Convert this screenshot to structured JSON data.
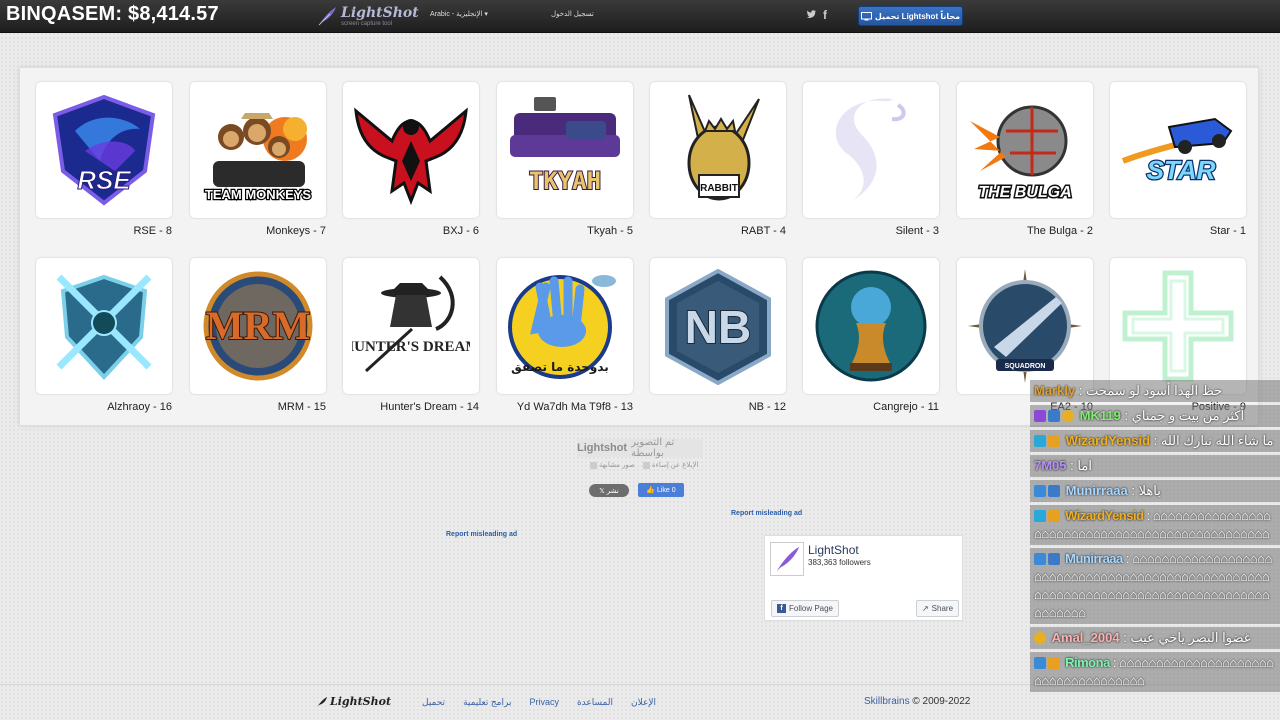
{
  "header": {
    "balance_text": "BINQASEM: $8,414.57",
    "logo_title": "LightShot",
    "logo_subtitle": "screen capture tool",
    "language": "Arabic - الإنجليزية",
    "login": "تسجيل الدخول",
    "download_button": "تحميل Lightshot مجاناً"
  },
  "gallery": {
    "rows": [
      [
        {
          "label": "RSE - 8",
          "icon": "rse-logo-icon"
        },
        {
          "label": "Monkeys - 7",
          "icon": "team-monkeys-logo-icon"
        },
        {
          "label": "BXJ - 6",
          "icon": "red-eagle-logo-icon"
        },
        {
          "label": "Tkyah - 5",
          "icon": "tkyah-couch-logo-icon"
        },
        {
          "label": "RABT - 4",
          "icon": "rabbit-logo-icon"
        },
        {
          "label": "Silent - 3",
          "icon": "silent-s-logo-icon"
        },
        {
          "label": "The Bulga - 2",
          "icon": "the-bulga-logo-icon"
        },
        {
          "label": "Star - 1",
          "icon": "star-car-logo-icon"
        }
      ],
      [
        {
          "label": "Alzhraoy - 16",
          "icon": "crossed-swords-shield-icon"
        },
        {
          "label": "MRM - 15",
          "icon": "mrm-logo-icon"
        },
        {
          "label": "Hunter's Dream - 14",
          "icon": "hunters-dream-logo-icon"
        },
        {
          "label": "Yd Wa7dh Ma T9f8 - 13",
          "icon": "crying-hand-logo-icon"
        },
        {
          "label": "NB - 12",
          "icon": "nb-hexagon-logo-icon"
        },
        {
          "label": "Cangrejo - 11",
          "icon": "trophy-logo-icon"
        },
        {
          "label": "EA2 - 10",
          "icon": "squadron-jet-logo-icon"
        },
        {
          "label": "Positive - 9",
          "icon": "positive-cross-logo-icon"
        }
      ]
    ],
    "logo_texts": {
      "rse": "RSE",
      "team_monkeys": "TEAM MONKEYS",
      "tkyah": "TKYAH",
      "rabbit": "RABBIT",
      "bulga": "THE BULGA",
      "star": "STAR",
      "mrm": "MRM",
      "hunters": "HUNTER'S DREAM",
      "nb": "NB",
      "squadron": "SQUADRON",
      "crying_hand": "بدوحدة ما تصفق"
    }
  },
  "share": {
    "shot_by_prefix": "تم التصوير بواسطة",
    "shot_by_brand": "Lightshot",
    "report": "الإبلاغ عن إساءة",
    "similar": "صور مشابهة",
    "post_x": "نشر",
    "like": "Like 0",
    "report_ad_1": "Report misleading ad",
    "report_ad_2": "Report misleading ad"
  },
  "fb_widget": {
    "page_name": "LightShot",
    "followers": "383,363 followers",
    "follow": "Follow Page",
    "share": "Share"
  },
  "footer": {
    "logo": "LightShot",
    "links": [
      "تحميل",
      "برامج تعليمية",
      "Privacy",
      "المساعدة",
      "الإعلان"
    ],
    "copyright_brand": "Skillbrains",
    "copyright_rest": " © 2009-2022"
  },
  "chat": {
    "messages": [
      {
        "user": "Markly",
        "text": ": حظ الهدا أسود لو سمحت",
        "user_color": "#e0a030"
      },
      {
        "user": "MK119",
        "text": ": أكثر من بيت و جمناي",
        "user_color": "#7cf06a"
      },
      {
        "user": "WizardYensid",
        "text": ": ما شاء الله تبارك الله",
        "user_color": "#f0b020"
      },
      {
        "user": "7M05",
        "text": ": اما",
        "user_color": "#b890ff"
      },
      {
        "user": "Munirraaa",
        "text": ": باهلا",
        "user_color": "#a8d8ff"
      },
      {
        "user": "WizardYensid",
        "text": ": ⌂⌂⌂⌂⌂⌂⌂⌂⌂⌂⌂⌂⌂⌂⌂⌂⌂⌂⌂⌂⌂⌂⌂⌂⌂⌂⌂⌂⌂⌂⌂⌂⌂⌂⌂⌂⌂⌂⌂⌂⌂⌂⌂⌂⌂⌂⌂⌂",
        "user_color": "#f0b020"
      },
      {
        "user": "Munirraaa",
        "text": ": ⌂⌂⌂⌂⌂⌂⌂⌂⌂⌂⌂⌂⌂⌂⌂⌂⌂⌂⌂⌂⌂⌂⌂⌂⌂⌂⌂⌂⌂⌂⌂⌂⌂⌂⌂⌂⌂⌂⌂⌂⌂⌂⌂⌂⌂⌂⌂⌂⌂⌂⌂⌂⌂⌂⌂⌂⌂⌂⌂⌂⌂⌂⌂⌂⌂⌂⌂⌂⌂⌂⌂⌂⌂⌂⌂⌂⌂⌂⌂⌂⌂⌂⌂⌂⌂⌂⌂⌂⌂⌂",
        "user_color": "#a8d8ff"
      },
      {
        "user": "Amal_2004",
        "text": ": غضوا البصر ياخي عيب",
        "user_color": "#ffb0b0"
      },
      {
        "user": "Rimona",
        "text": ": ⌂⌂⌂⌂⌂⌂⌂⌂⌂⌂⌂⌂⌂⌂⌂⌂⌂⌂⌂⌂⌂⌂⌂⌂⌂⌂⌂⌂⌂⌂⌂⌂⌂⌂⌂⌂",
        "user_color": "#80f0b0"
      }
    ]
  },
  "colors": {
    "topbar": "#2a2a2a",
    "download_button": "#2f64b3",
    "link": "#3a62a8",
    "gallery_panel": "#f3f3f3"
  }
}
